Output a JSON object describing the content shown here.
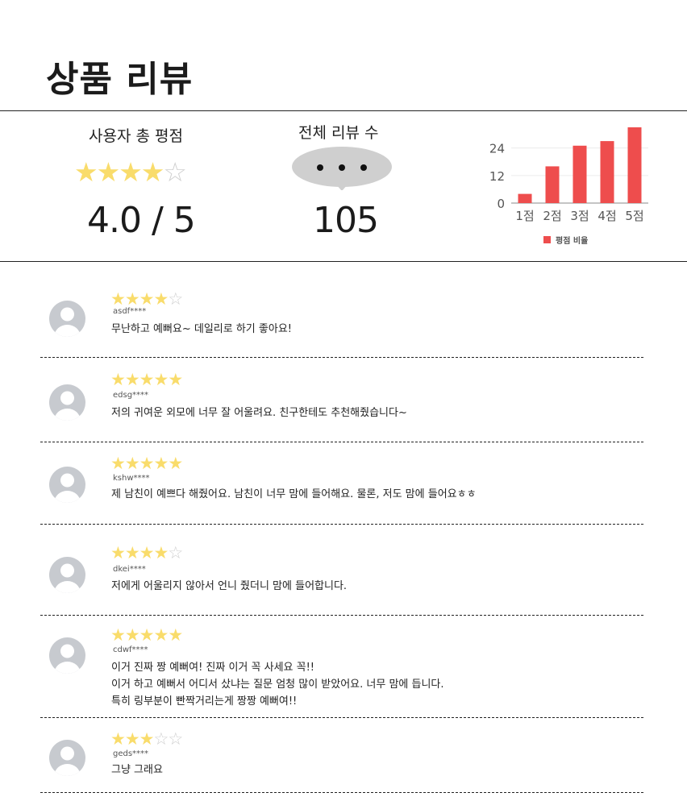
{
  "page": {
    "title": "상품 리뷰"
  },
  "summary": {
    "rating_label": "사용자 총 평점",
    "rating_stars": 4,
    "rating_value": "4.0 / 5",
    "count_label": "전체 리뷰 수",
    "count_value": "105"
  },
  "chart_data": {
    "type": "bar",
    "categories": [
      "1점",
      "2점",
      "3점",
      "4점",
      "5점"
    ],
    "series": [
      {
        "name": "평점 비율",
        "values": [
          4,
          16,
          25,
          27,
          33
        ]
      }
    ],
    "yticks": [
      0,
      12,
      24
    ],
    "ylim": [
      0,
      33
    ],
    "grid": true,
    "legend": "bottom",
    "color": "#ee4d4d"
  },
  "reviews": [
    {
      "stars": 4,
      "user": "asdf****",
      "lines": [
        "무난하고 예뻐요~ 데일리로 하기 좋아요!"
      ]
    },
    {
      "stars": 5,
      "user": "edsg****",
      "lines": [
        "저의 귀여운 외모에 너무 잘 어울려요. 친구한테도 추천해줬습니다~"
      ]
    },
    {
      "stars": 5,
      "user": "kshw****",
      "lines": [
        "제 남친이 예쁘다 해줬어요. 남친이 너무 맘에 들어해요. 물론, 저도 맘에 들어요ㅎㅎ"
      ]
    },
    {
      "stars": 4,
      "user": "dkei****",
      "lines": [
        "저에게 어울리지 않아서 언니 줬더니 맘에 들어합니다."
      ]
    },
    {
      "stars": 5,
      "user": "cdwf****",
      "lines": [
        "이거 진짜 짱 예뻐여! 진짜 이거 꼭 사세요 꼭!!",
        "이거 하고 예뻐서 어디서 샀냐는 질문 엄청 많이 받았어요. 너무 맘에 듭니다.",
        "특히 링부분이 빤짝거리는게 짱짱 예뻐여!!"
      ]
    },
    {
      "stars": 3,
      "user": "geds****",
      "lines": [
        "그냥 그래요"
      ]
    }
  ],
  "colors": {
    "star_on": "#f9dc6b",
    "star_off": "#cfcfcf",
    "bar": "#ee4d4d",
    "avatar": "#c7cacf"
  },
  "icons": {
    "avatar": "user-avatar-icon",
    "bubble": "speech-bubble-icon",
    "star": "star-icon"
  }
}
